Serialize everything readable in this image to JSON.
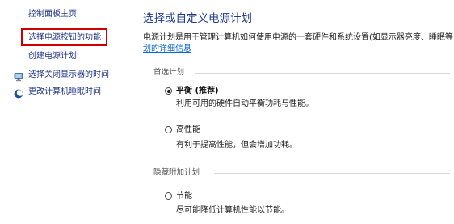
{
  "sidebar": {
    "home": "控制面板主页",
    "items": [
      {
        "label": "选择电源按钮的功能",
        "icon": "",
        "highlighted": true
      },
      {
        "label": "创建电源计划",
        "icon": ""
      },
      {
        "label": "选择关闭显示器的时间",
        "icon": "monitor-icon"
      },
      {
        "label": "更改计算机睡眠时间",
        "icon": "moon-icon"
      }
    ]
  },
  "main": {
    "title": "选择或自定义电源计划",
    "description": "电源计划是用于管理计算机如何使用电源的一套硬件和系统设置(如显示器亮度、睡眠等",
    "details_link": "划的详细信息",
    "preferred_group": "首选计划",
    "hidden_group": "隐藏附加计划",
    "plans": [
      {
        "name": "平衡 (推荐)",
        "desc": "利用可用的硬件自动平衡功耗与性能。",
        "checked": true
      },
      {
        "name": "高性能",
        "desc": "有利于提高性能，但会增加功耗。",
        "checked": false
      },
      {
        "name": "节能",
        "desc": "尽可能降低计算机性能以节能。",
        "checked": false
      }
    ]
  },
  "colors": {
    "highlight_border": "#cc0000",
    "title": "#1e3a8a",
    "link": "#0b67c9"
  }
}
